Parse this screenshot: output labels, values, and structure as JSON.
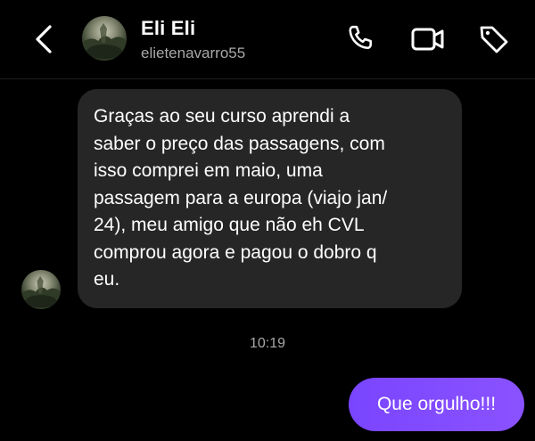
{
  "header": {
    "name": "Eli Eli",
    "handle": "elietenavarro55",
    "icons": [
      "back-chevron-icon",
      "phone-icon",
      "video-camera-icon",
      "tag-icon"
    ]
  },
  "conversation": {
    "incoming_message": "Graças ao seu curso aprendi a\nsaber o preço das passagens, com\nisso comprei em maio, uma\npassagem para a europa (viajo jan/\n24), meu amigo que não eh CVL\ncomprou agora e pagou o dobro q\neu.",
    "timestamp": "10:19",
    "outgoing_message": "Que orgulho!!!"
  },
  "colors": {
    "background": "#000000",
    "incoming_bubble": "#262626",
    "outgoing_bubble": "#7c4dff",
    "secondary_text": "#a8a8a8"
  }
}
